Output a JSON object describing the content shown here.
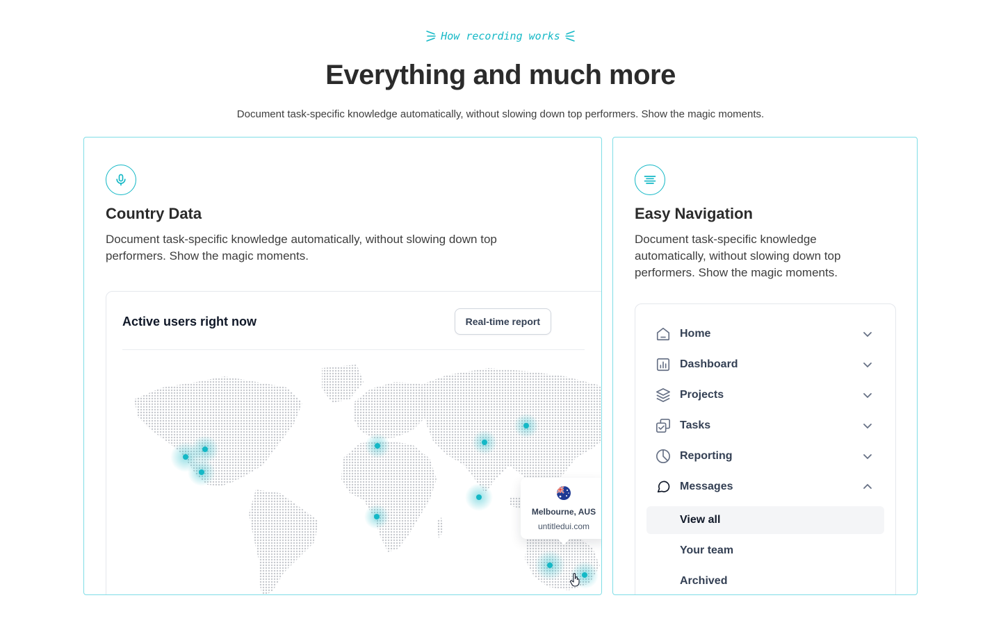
{
  "header": {
    "eyebrow": "How recording works",
    "title": "Everything and much more",
    "subtitle": "Document task-specific knowledge automatically, without slowing down top performers. Show the magic moments."
  },
  "colors": {
    "accent": "#14b8c6",
    "border": "#7fdde6",
    "heading": "#2b2b2b"
  },
  "country_card": {
    "icon": "microphone-icon",
    "title": "Country Data",
    "description": "Document task-specific knowledge automatically, without slowing down top performers. Show the magic moments.",
    "map": {
      "title": "Active users right now",
      "report_button": "Real-time report",
      "tooltip": {
        "flag": "australia-flag-icon",
        "city": "Melbourne, AUS",
        "site": "untitledui.com"
      }
    }
  },
  "nav_card": {
    "icon": "align-center-icon",
    "title": "Easy Navigation",
    "description": "Document task-specific knowledge automatically, without slowing down top performers. Show the magic moments.",
    "items": [
      {
        "label": "Home",
        "icon": "home-icon",
        "expanded": false
      },
      {
        "label": "Dashboard",
        "icon": "bar-chart-icon",
        "expanded": false
      },
      {
        "label": "Projects",
        "icon": "layers-icon",
        "expanded": false
      },
      {
        "label": "Tasks",
        "icon": "check-square-icon",
        "expanded": false
      },
      {
        "label": "Reporting",
        "icon": "pie-chart-icon",
        "expanded": false
      },
      {
        "label": "Messages",
        "icon": "message-icon",
        "expanded": true
      }
    ],
    "sub_items": [
      {
        "label": "View all",
        "active": true
      },
      {
        "label": "Your team",
        "active": false
      },
      {
        "label": "Archived",
        "active": false
      }
    ]
  }
}
